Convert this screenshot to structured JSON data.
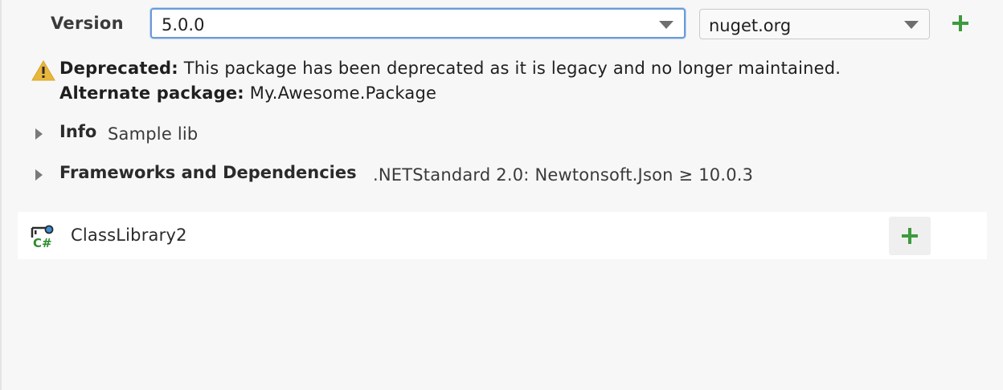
{
  "version": {
    "label": "Version",
    "selected": "5.0.0"
  },
  "source": {
    "selected": "nuget.org"
  },
  "deprecation": {
    "label": "Deprecated:",
    "message": "This package has been deprecated as it is legacy and no longer maintained.",
    "alternate_label": "Alternate package:",
    "alternate_value": "My.Awesome.Package"
  },
  "sections": {
    "info": {
      "title": "Info",
      "value": "Sample lib"
    },
    "frameworks": {
      "title": "Frameworks and Dependencies",
      "value": ".NETStandard 2.0: Newtonsoft.Json ≥ 10.0.3"
    }
  },
  "project": {
    "name": "ClassLibrary2",
    "icon": "csharp-project-icon"
  },
  "colors": {
    "accent_green": "#3d9a3d",
    "focus_border": "#6a9bd8",
    "warning": "#e8b63b"
  }
}
